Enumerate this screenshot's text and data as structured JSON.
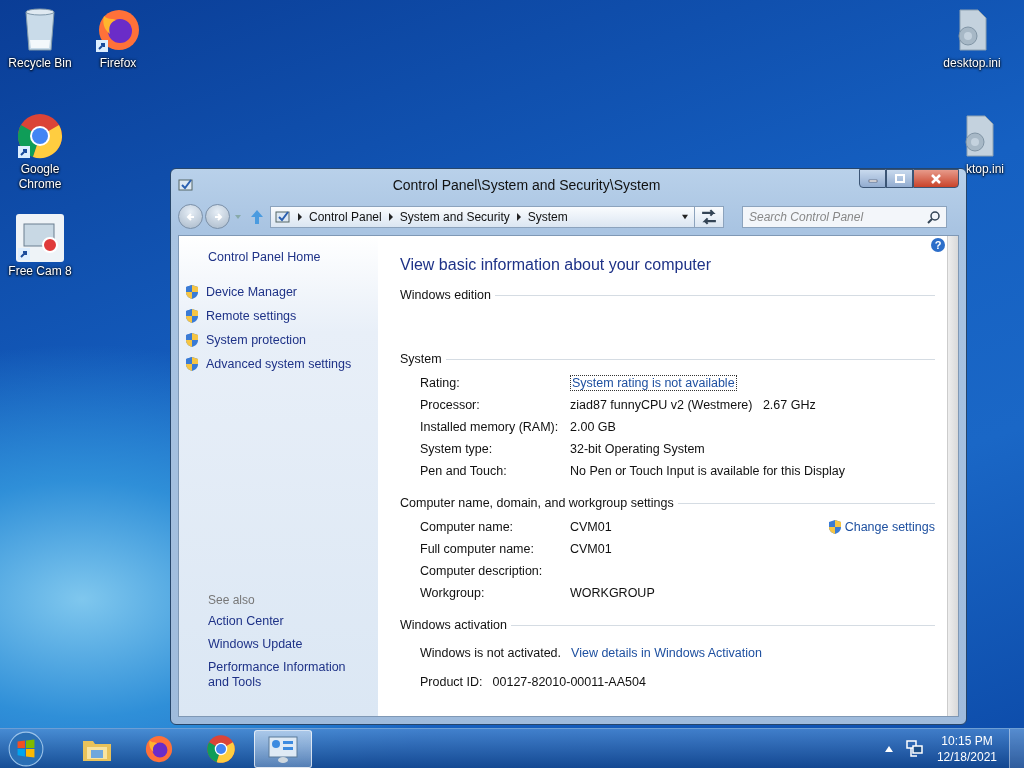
{
  "desktop_icons": [
    {
      "label": "Recycle Bin",
      "kind": "recycle"
    },
    {
      "label": "Firefox",
      "kind": "firefox"
    },
    {
      "label": "Google Chrome",
      "kind": "chrome"
    },
    {
      "label": "Free Cam 8",
      "kind": "freecam"
    },
    {
      "label": "desktop.ini",
      "kind": "ini"
    },
    {
      "label": "ktop.ini",
      "kind": "ini-covered"
    }
  ],
  "window": {
    "title": "Control Panel\\System and Security\\System",
    "address": [
      "Control Panel",
      "System and Security",
      "System"
    ],
    "search": {
      "placeholder": "Search Control Panel"
    },
    "help": "?",
    "sidebar": {
      "home": "Control Panel Home",
      "tasks": [
        "Device Manager",
        "Remote settings",
        "System protection",
        "Advanced system settings"
      ],
      "see_also_heading": "See also",
      "see_also": [
        "Action Center",
        "Windows Update",
        "Performance Information and Tools"
      ]
    },
    "heading": "View basic information about your computer",
    "sections": [
      {
        "title": "Windows edition"
      },
      {
        "title": "System",
        "rows": [
          {
            "label": "Rating:",
            "value": "System rating is not available",
            "kind": "link"
          },
          {
            "label": "Processor:",
            "value": "ziad87 funnyCPU v2 (Westmere)   2.67 GHz",
            "kind": "text"
          },
          {
            "label": "Installed memory (RAM):",
            "value": "2.00 GB",
            "kind": "text"
          },
          {
            "label": "System type:",
            "value": "32-bit Operating System",
            "kind": "text"
          },
          {
            "label": "Pen and Touch:",
            "value": "No Pen or Touch Input is available for this Display",
            "kind": "text"
          }
        ]
      },
      {
        "title": "Computer name, domain, and workgroup settings",
        "action": "Change settings",
        "rows": [
          {
            "label": "Computer name:",
            "value": "CVM01",
            "kind": "text"
          },
          {
            "label": "Full computer name:",
            "value": "CVM01",
            "kind": "text"
          },
          {
            "label": "Computer description:",
            "kind": "text"
          },
          {
            "label": "Workgroup:",
            "value": "WORKGROUP",
            "kind": "text"
          }
        ]
      },
      {
        "title": "Windows activation",
        "rows": [
          {
            "label": "Windows is not activated.",
            "value": "View details in Windows Activation",
            "kind": "inline-link"
          },
          {
            "label": "Product ID:",
            "value": "00127-82010-00011-AA504",
            "kind": "inline"
          }
        ]
      }
    ]
  },
  "taskbar": {
    "items": [
      {
        "kind": "explorer",
        "selected": false
      },
      {
        "kind": "firefox",
        "selected": false
      },
      {
        "kind": "chrome",
        "selected": false
      },
      {
        "kind": "control-panel",
        "selected": true
      }
    ],
    "time": "10:15 PM",
    "date": "12/18/2021"
  }
}
